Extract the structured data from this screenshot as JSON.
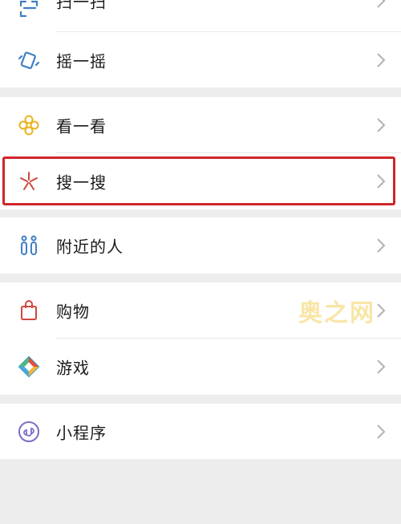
{
  "menu": {
    "items": [
      {
        "label": "扫一扫",
        "icon": "scan-icon"
      },
      {
        "label": "摇一摇",
        "icon": "shake-icon"
      },
      {
        "label": "看一看",
        "icon": "top-stories-icon"
      },
      {
        "label": "搜一搜",
        "icon": "search-sparkle-icon"
      },
      {
        "label": "附近的人",
        "icon": "people-nearby-icon"
      },
      {
        "label": "购物",
        "icon": "shopping-bag-icon"
      },
      {
        "label": "游戏",
        "icon": "games-icon"
      },
      {
        "label": "小程序",
        "icon": "mini-programs-icon"
      }
    ]
  },
  "watermark": "奥之网",
  "colors": {
    "highlight_border": "#d0262a",
    "background": "#ededed",
    "row_background": "#ffffff"
  }
}
